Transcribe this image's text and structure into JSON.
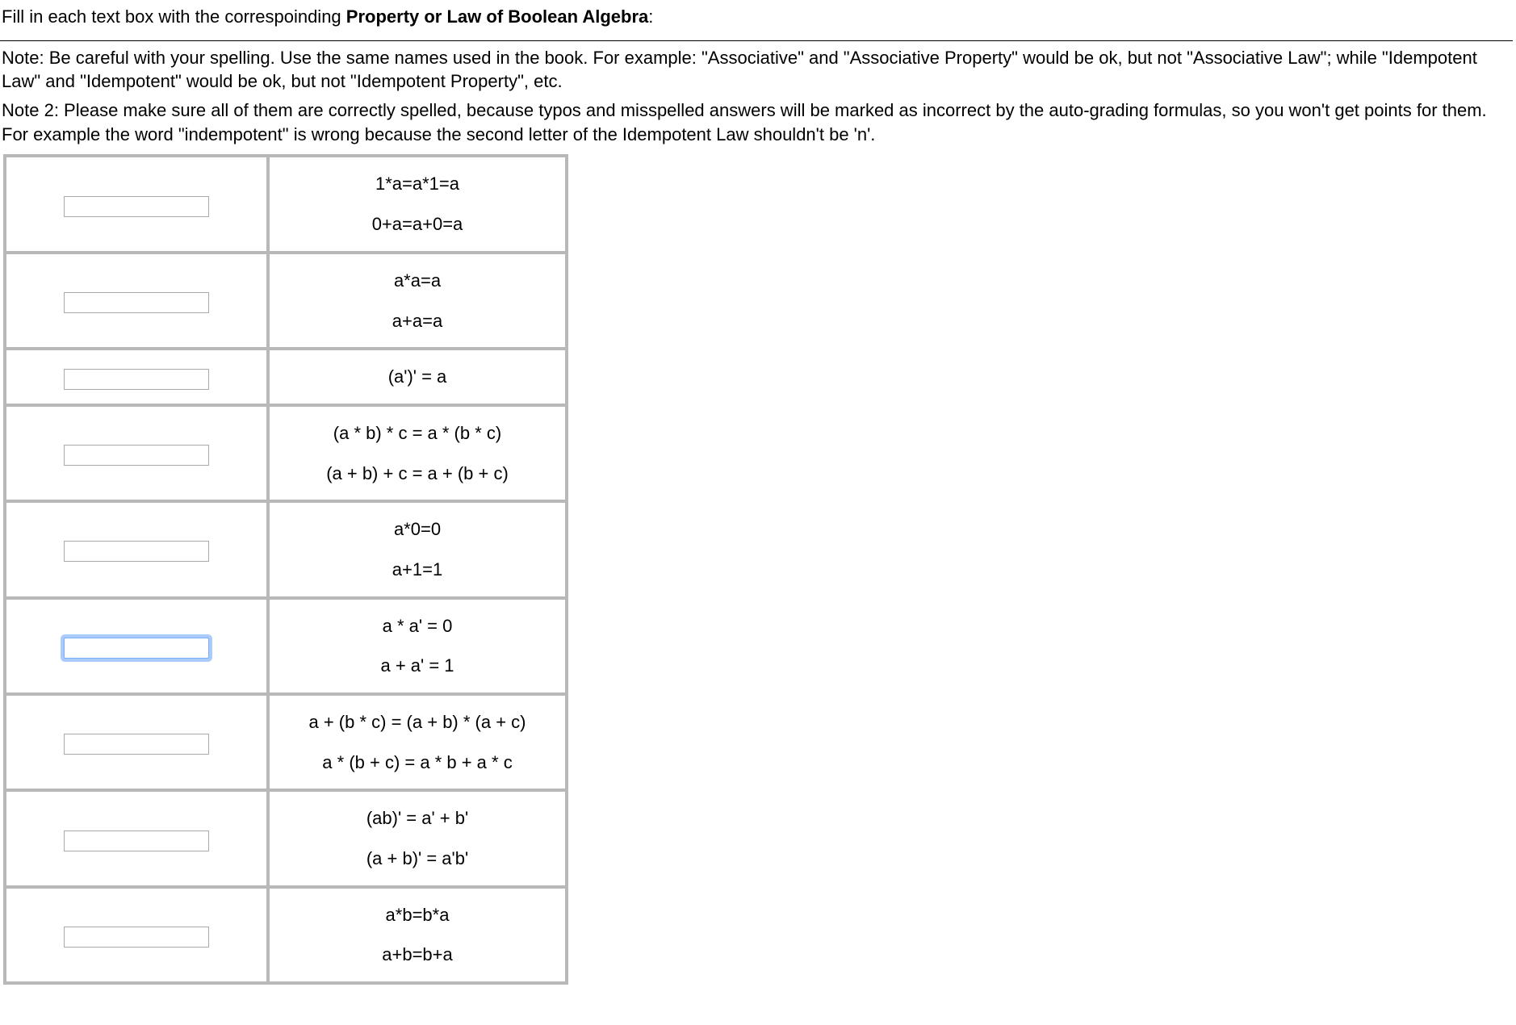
{
  "instructions": {
    "line1_pre": "Fill in each text box with the correspoinding ",
    "line1_bold": "Property or Law of Boolean Algebra",
    "line1_post": ":",
    "note1": "Note: Be careful with your spelling. Use the same names used in the book. For example: \"Associative\" and \"Associative Property\" would be ok, but not \"Associative Law\"; while \"Idempotent Law\" and \"Idempotent\" would be ok, but not \"Idempotent Property\", etc.",
    "note2": "Note 2: Please make sure all of them are correctly spelled, because typos and misspelled answers will be marked as incorrect by the auto-grading formulas, so you won't get points for them. For example the word \"indempotent\" is wrong because the second letter of the Idempotent Law shouldn't be 'n'."
  },
  "rows": [
    {
      "answer": "",
      "focused": false,
      "formulas": [
        "1*a=a*1=a",
        "0+a=a+0=a"
      ],
      "split": false
    },
    {
      "answer": "",
      "focused": false,
      "formulas": [
        "a*a=a",
        "a+a=a"
      ],
      "split": false
    },
    {
      "answer": "",
      "focused": false,
      "formulas": [
        "(a')' = a"
      ],
      "split": false,
      "single": true
    },
    {
      "answer": "",
      "focused": false,
      "formulas": [
        "(a * b) * c = a * (b * c)",
        "(a + b) + c = a + (b + c)"
      ],
      "split": false
    },
    {
      "answer": "",
      "focused": false,
      "formulas": [
        "a*0=0",
        "a+1=1"
      ],
      "split": false
    },
    {
      "answer": "",
      "focused": true,
      "formulas": [
        "a * a' = 0",
        "a + a' = 1"
      ],
      "split": false
    },
    {
      "answer": "",
      "focused": false,
      "formulas": [
        "a + (b * c) = (a + b) * (a + c)",
        "a * (b + c) = a * b + a * c"
      ],
      "split": false
    },
    {
      "answer": "",
      "focused": false,
      "formulas": [
        "(ab)' = a' + b'",
        "(a + b)' = a'b'"
      ],
      "split": false
    },
    {
      "answer": "",
      "focused": false,
      "formulas": [
        "a*b=b*a",
        "a+b=b+a"
      ],
      "split": false
    }
  ]
}
